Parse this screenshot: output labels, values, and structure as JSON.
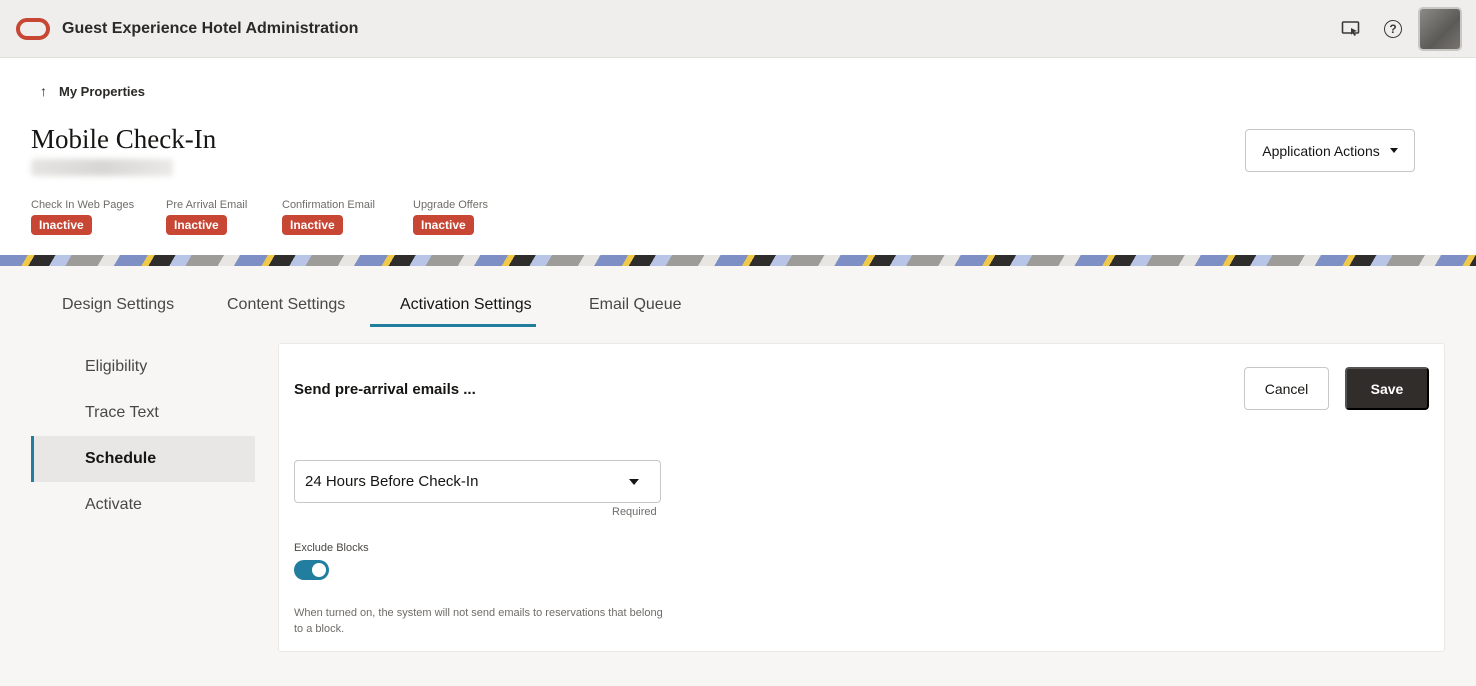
{
  "app": {
    "title": "Guest Experience Hotel Administration",
    "logo_icon": "oracle-logo",
    "icons": [
      "screen-share-icon",
      "help-icon",
      "user-avatar"
    ]
  },
  "header": {
    "back_link": "My Properties",
    "page_title": "Mobile Check-In",
    "actions_button": "Application Actions",
    "statuses": [
      {
        "label": "Check In Web Pages",
        "status": "Inactive"
      },
      {
        "label": "Pre Arrival Email",
        "status": "Inactive"
      },
      {
        "label": "Confirmation Email",
        "status": "Inactive"
      },
      {
        "label": "Upgrade Offers",
        "status": "Inactive"
      }
    ]
  },
  "tabs": [
    {
      "label": "Design Settings",
      "active": false
    },
    {
      "label": "Content Settings",
      "active": false
    },
    {
      "label": "Activation Settings",
      "active": true
    },
    {
      "label": "Email Queue",
      "active": false
    }
  ],
  "sidebar": {
    "items": [
      {
        "label": "Eligibility",
        "active": false
      },
      {
        "label": "Trace Text",
        "active": false
      },
      {
        "label": "Schedule",
        "active": true
      },
      {
        "label": "Activate",
        "active": false
      }
    ]
  },
  "panel": {
    "heading": "Send pre-arrival emails ...",
    "cancel_label": "Cancel",
    "save_label": "Save",
    "schedule_select": {
      "value": "24 Hours Before Check-In",
      "hint": "Required"
    },
    "exclude_blocks": {
      "label": "Exclude Blocks",
      "on": true,
      "help": "When turned on, the system will not send emails to reservations that belong to a block."
    }
  },
  "colors": {
    "brand_red": "#c74634",
    "accent_teal": "#227e9e",
    "primary_button": "#312d2a"
  }
}
